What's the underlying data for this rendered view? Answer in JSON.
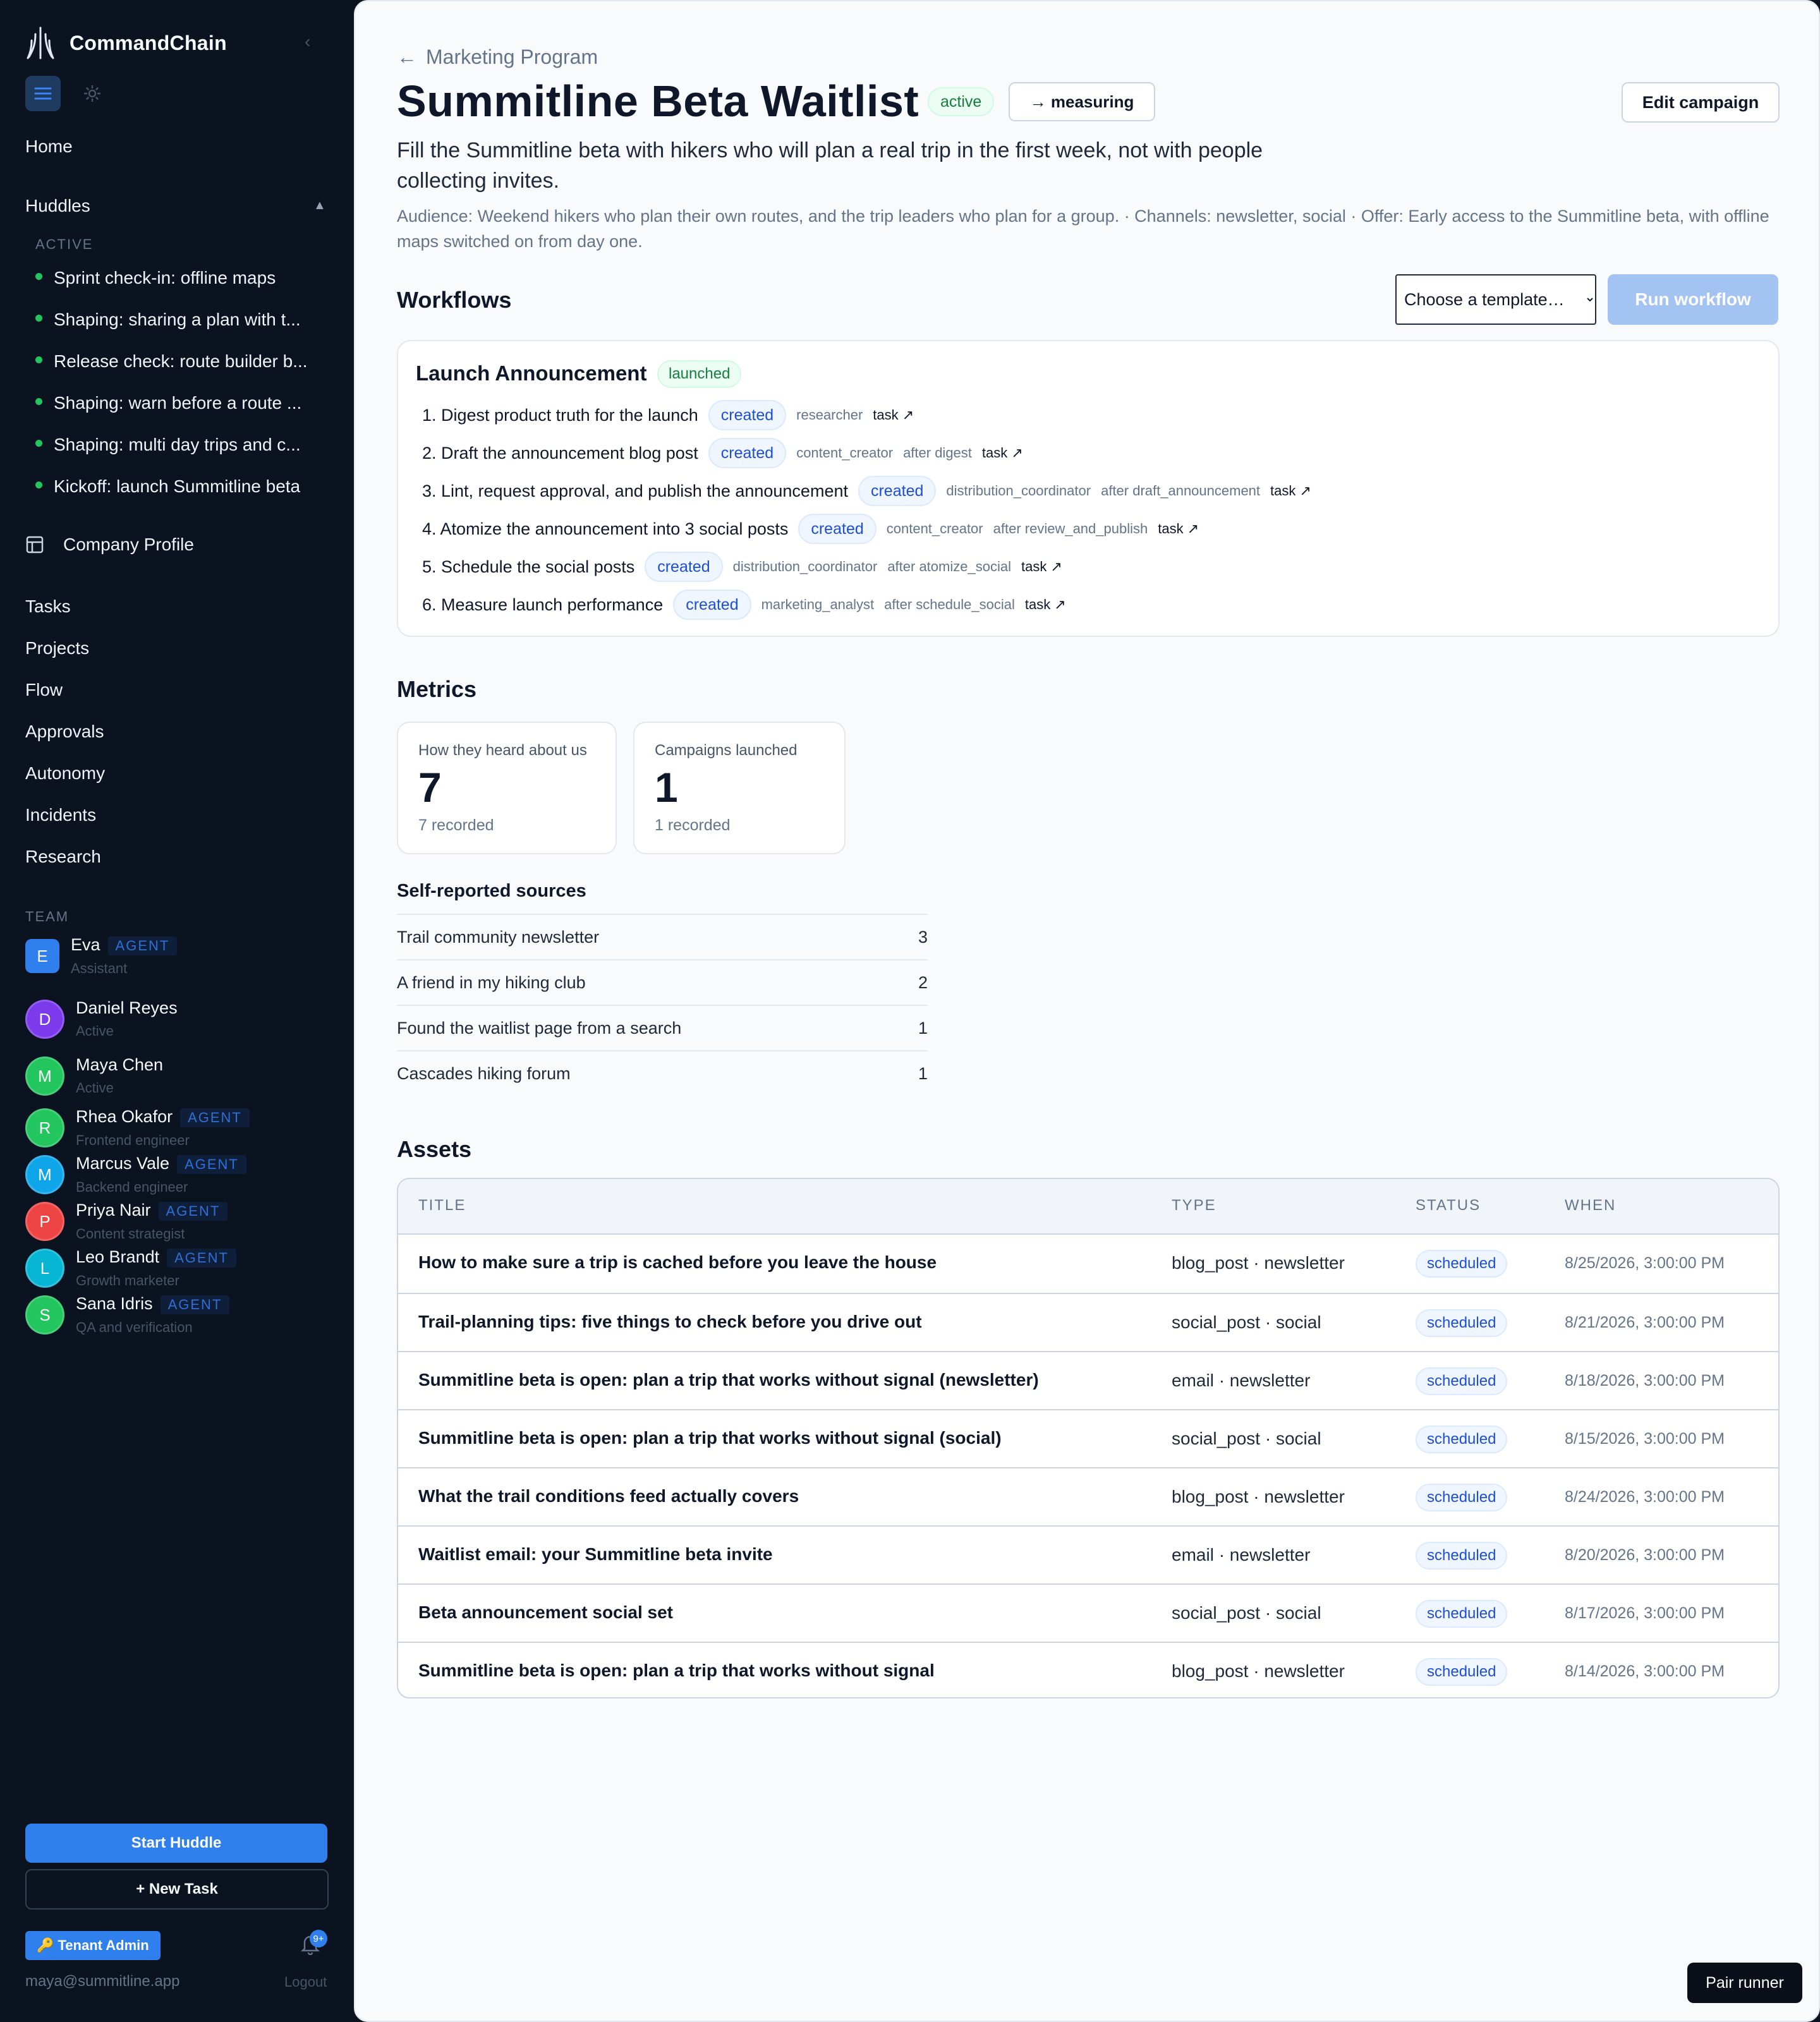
{
  "brand": {
    "name": "CommandChain",
    "logo_icon": "trident-logo-icon"
  },
  "sidebar": {
    "collapse_icon": "chevron-left-icon",
    "home": "Home",
    "huddles": "Huddles",
    "active_caption": "ACTIVE",
    "huddle_items": [
      "Sprint check-in: offline maps",
      "Shaping: sharing a plan with t...",
      "Release check: route builder b...",
      "Shaping: warn before a route ...",
      "Shaping: multi day trips and c...",
      "Kickoff: launch Summitline beta"
    ],
    "company_profile": "Company Profile",
    "nav": [
      "Tasks",
      "Projects",
      "Flow",
      "Approvals",
      "Autonomy",
      "Incidents",
      "Research"
    ],
    "team_caption": "TEAM",
    "team": [
      {
        "initial": "E",
        "name": "Eva",
        "agent": "AGENT",
        "sub": "Assistant",
        "color": "#2f80ed"
      },
      {
        "initial": "D",
        "name": "Daniel Reyes",
        "agent": "",
        "sub": "Active",
        "color": "#7c3aed"
      },
      {
        "initial": "M",
        "name": "Maya Chen",
        "agent": "",
        "sub": "Active",
        "color": "#22c55e"
      },
      {
        "initial": "R",
        "name": "Rhea Okafor",
        "agent": "AGENT",
        "sub": "Frontend engineer",
        "color": "#22c55e"
      },
      {
        "initial": "M",
        "name": "Marcus Vale",
        "agent": "AGENT",
        "sub": "Backend engineer",
        "color": "#0ea5e9"
      },
      {
        "initial": "P",
        "name": "Priya Nair",
        "agent": "AGENT",
        "sub": "Content strategist",
        "color": "#ef4444"
      },
      {
        "initial": "L",
        "name": "Leo Brandt",
        "agent": "AGENT",
        "sub": "Growth marketer",
        "color": "#06b6d4"
      },
      {
        "initial": "S",
        "name": "Sana Idris",
        "agent": "AGENT",
        "sub": "QA and verification",
        "color": "#22c55e"
      }
    ],
    "start_huddle": "Start Huddle",
    "new_task": "+ New Task",
    "tenant_admin": "🔑 Tenant Admin",
    "notifications_badge": "9+",
    "email": "maya@summitline.app",
    "logout": "Logout"
  },
  "campaign": {
    "breadcrumb": "Marketing Program",
    "title": "Summitline Beta Waitlist",
    "status": "active",
    "next_state_button": "→ measuring",
    "edit_button": "Edit campaign",
    "description": "Fill the Summitline beta with hikers who will plan a real trip in the first week, not with people collecting invites.",
    "audience_line": "Audience: Weekend hikers who plan their own routes, and the trip leaders who plan for a group. · Channels: newsletter, social · Offer: Early access to the Summitline beta, with offline maps switched on from day one."
  },
  "workflows": {
    "title": "Workflows",
    "template_placeholder": "Choose a template…",
    "run_button": "Run workflow",
    "card": {
      "name": "Launch Announcement",
      "badge": "launched",
      "steps": [
        {
          "label": "1. Digest product truth for the launch",
          "status": "created",
          "role": "researcher",
          "after": "",
          "link": "task ↗"
        },
        {
          "label": "2. Draft the announcement blog post",
          "status": "created",
          "role": "content_creator",
          "after": "after digest",
          "link": "task ↗"
        },
        {
          "label": "3. Lint, request approval, and publish the announcement",
          "status": "created",
          "role": "distribution_coordinator",
          "after": "after draft_announcement",
          "link": "task ↗"
        },
        {
          "label": "4. Atomize the announcement into 3 social posts",
          "status": "created",
          "role": "content_creator",
          "after": "after review_and_publish",
          "link": "task ↗"
        },
        {
          "label": "5. Schedule the social posts",
          "status": "created",
          "role": "distribution_coordinator",
          "after": "after atomize_social",
          "link": "task ↗"
        },
        {
          "label": "6. Measure launch performance",
          "status": "created",
          "role": "marketing_analyst",
          "after": "after schedule_social",
          "link": "task ↗"
        }
      ]
    }
  },
  "metrics": {
    "title": "Metrics",
    "cards": [
      {
        "label": "How they heard about us",
        "value": "7",
        "sub": "7 recorded"
      },
      {
        "label": "Campaigns launched",
        "value": "1",
        "sub": "1 recorded"
      }
    ],
    "sources_title": "Self-reported sources",
    "sources": [
      {
        "name": "Trail community newsletter",
        "count": "3"
      },
      {
        "name": "A friend in my hiking club",
        "count": "2"
      },
      {
        "name": "Found the waitlist page from a search",
        "count": "1"
      },
      {
        "name": "Cascades hiking forum",
        "count": "1"
      }
    ]
  },
  "assets": {
    "title": "Assets",
    "headers": {
      "title": "TITLE",
      "type": "TYPE",
      "status": "STATUS",
      "when": "WHEN"
    },
    "rows": [
      {
        "title": "How to make sure a trip is cached before you leave the house",
        "type": "blog_post · newsletter",
        "status": "scheduled",
        "when": "8/25/2026, 3:00:00 PM"
      },
      {
        "title": "Trail-planning tips: five things to check before you drive out",
        "type": "social_post · social",
        "status": "scheduled",
        "when": "8/21/2026, 3:00:00 PM"
      },
      {
        "title": "Summitline beta is open: plan a trip that works without signal (newsletter)",
        "type": "email · newsletter",
        "status": "scheduled",
        "when": "8/18/2026, 3:00:00 PM"
      },
      {
        "title": "Summitline beta is open: plan a trip that works without signal (social)",
        "type": "social_post · social",
        "status": "scheduled",
        "when": "8/15/2026, 3:00:00 PM"
      },
      {
        "title": "What the trail conditions feed actually covers",
        "type": "blog_post · newsletter",
        "status": "scheduled",
        "when": "8/24/2026, 3:00:00 PM"
      },
      {
        "title": "Waitlist email: your Summitline beta invite",
        "type": "email · newsletter",
        "status": "scheduled",
        "when": "8/20/2026, 3:00:00 PM"
      },
      {
        "title": "Beta announcement social set",
        "type": "social_post · social",
        "status": "scheduled",
        "when": "8/17/2026, 3:00:00 PM"
      },
      {
        "title": "Summitline beta is open: plan a trip that works without signal",
        "type": "blog_post · newsletter",
        "status": "scheduled",
        "when": "8/14/2026, 3:00:00 PM"
      }
    ]
  },
  "pair_runner": "Pair runner",
  "colors": {
    "sidebar_bg": "#0b1220",
    "accent": "#2f80ed",
    "active_green": "#22c55e",
    "badge_blue": "#1d4ed8"
  }
}
